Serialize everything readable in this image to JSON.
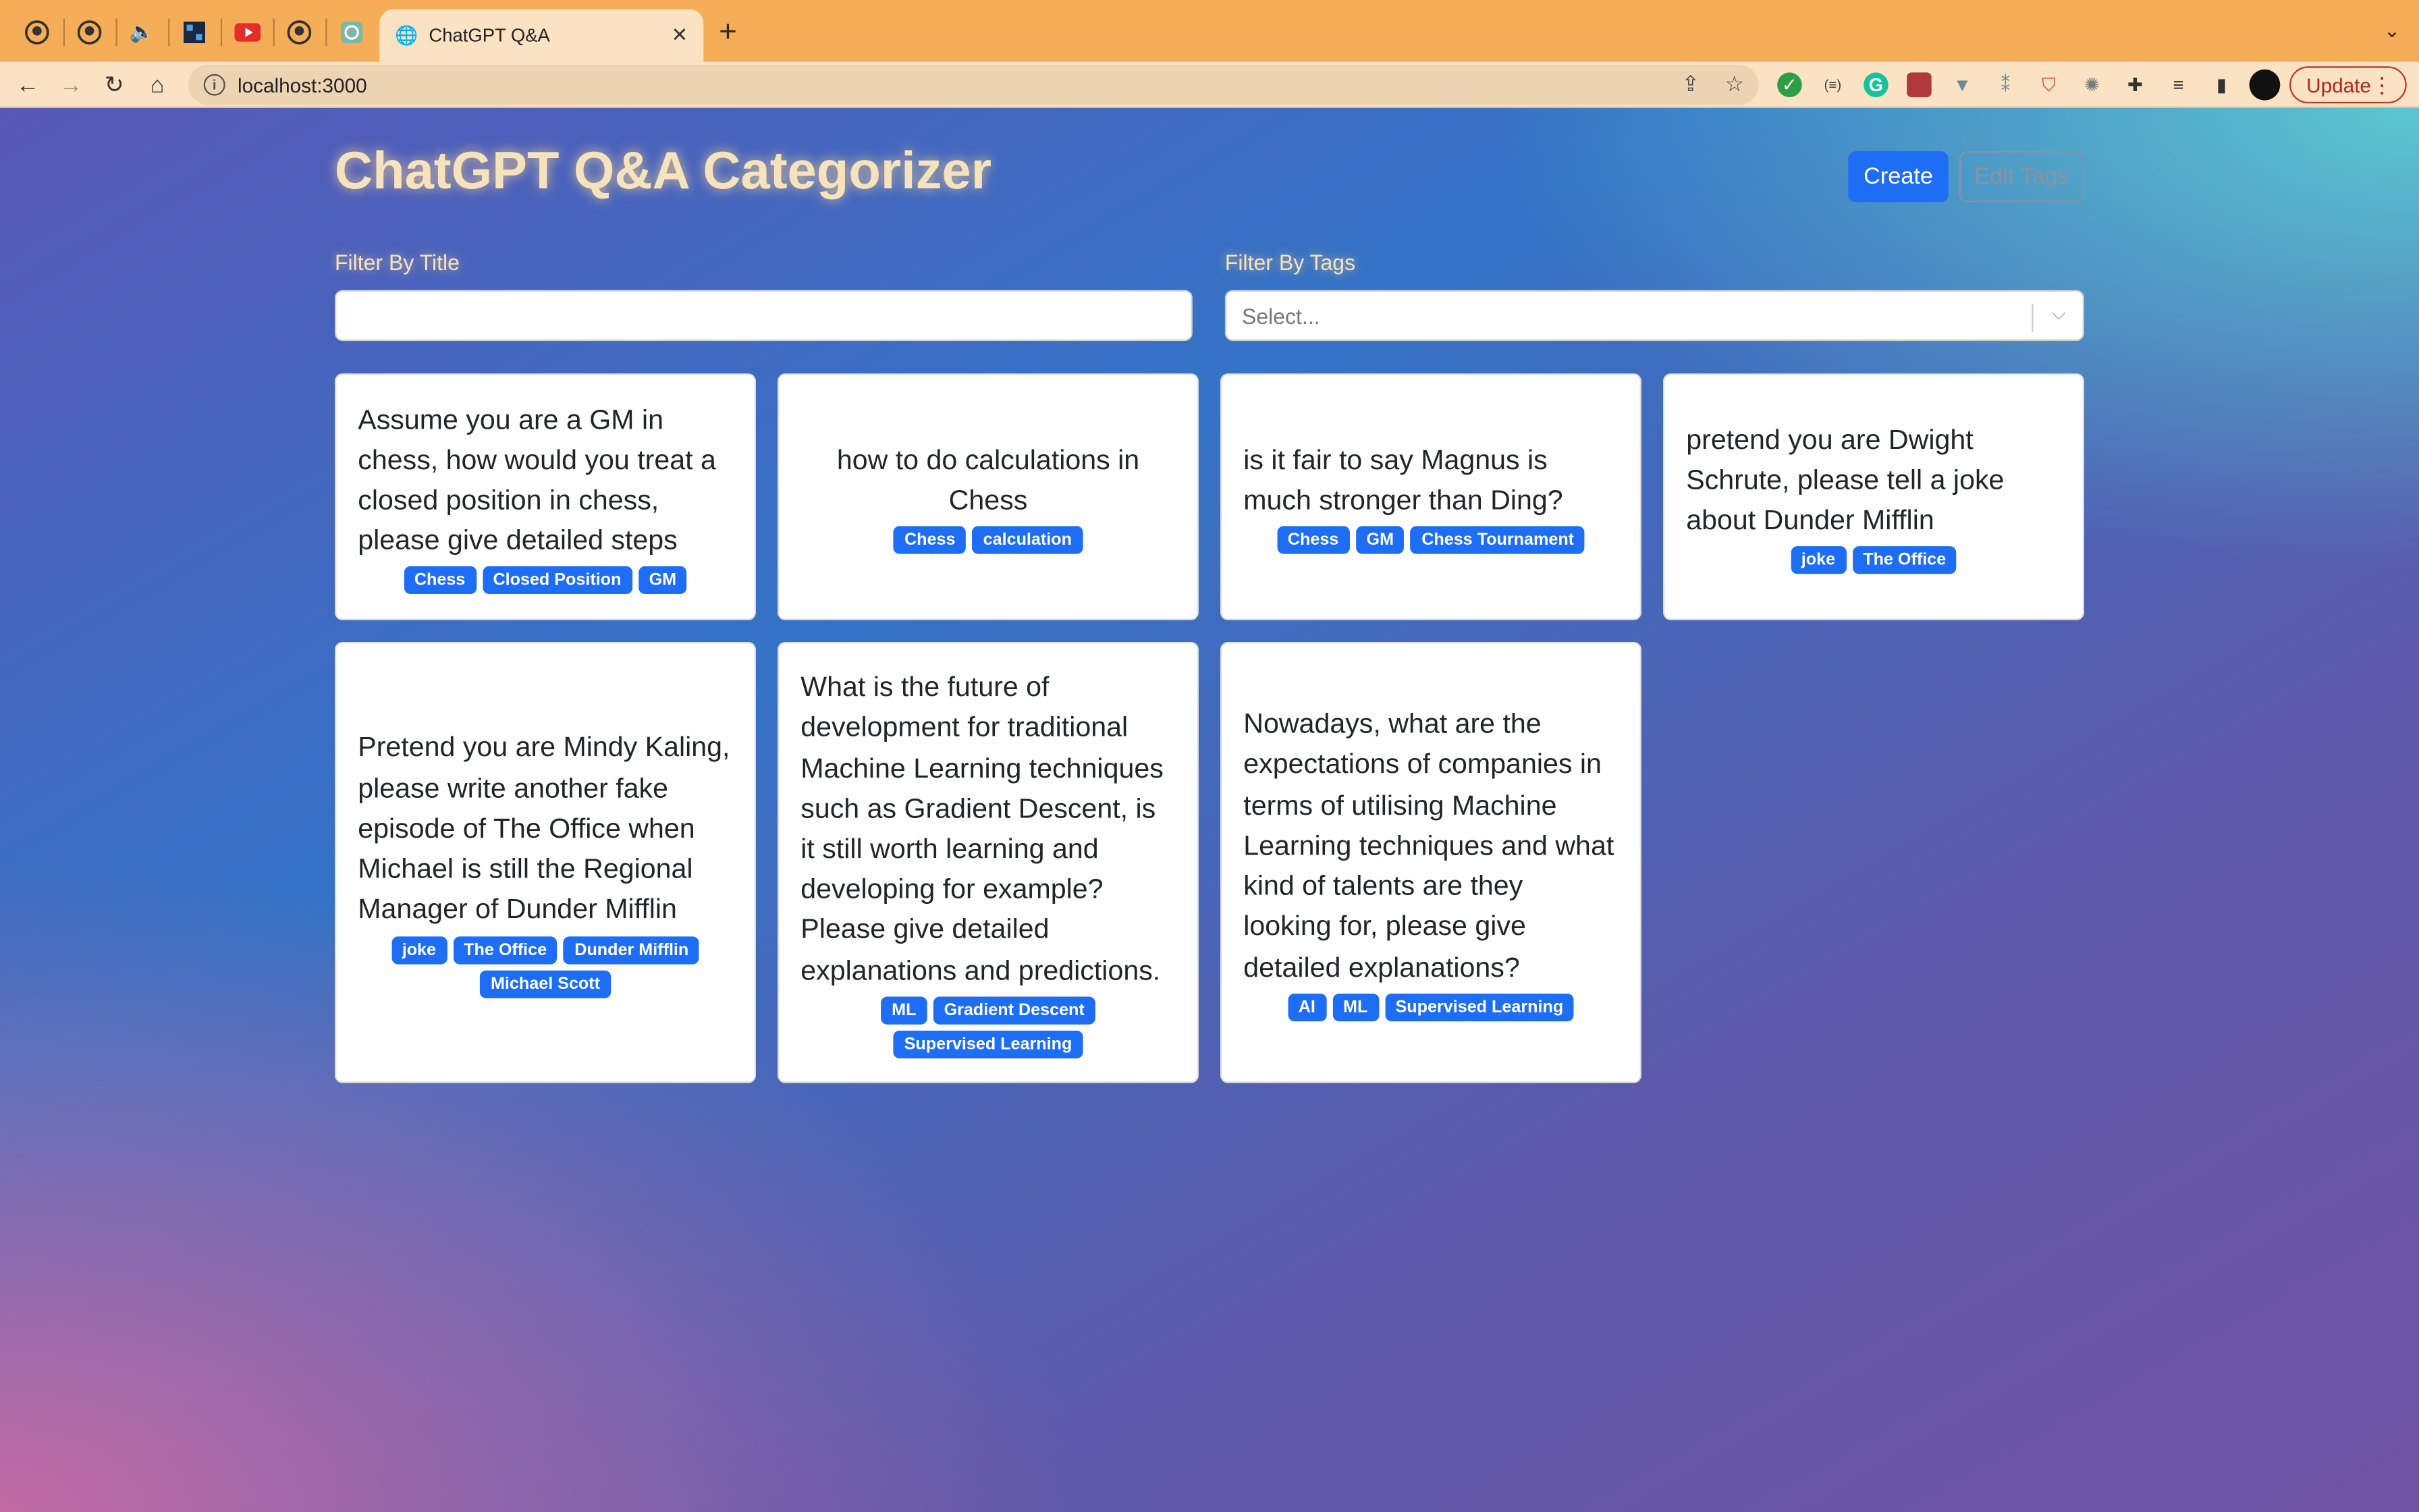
{
  "browser": {
    "tab_title": "ChatGPT Q&A",
    "url": "localhost:3000",
    "update_label": "Update"
  },
  "header": {
    "title": "ChatGPT Q&A Categorizer",
    "create_label": "Create",
    "edit_tags_label": "Edit Tags"
  },
  "filters": {
    "title_label": "Filter By Title",
    "title_value": "",
    "tags_label": "Filter By Tags",
    "tags_placeholder": "Select..."
  },
  "cards": [
    {
      "question": "Assume you are a GM in chess, how would you treat a closed position in chess, please give detailed steps",
      "tags": [
        "Chess",
        "Closed Position",
        "GM"
      ]
    },
    {
      "question": "how to do calculations in Chess",
      "tags": [
        "Chess",
        "calculation"
      ]
    },
    {
      "question": "is it fair to say Magnus is much stronger than Ding?",
      "tags": [
        "Chess",
        "GM",
        "Chess Tournament"
      ]
    },
    {
      "question": "pretend you are Dwight Schrute, please tell a joke about Dunder Mifflin",
      "tags": [
        "joke",
        "The Office"
      ]
    },
    {
      "question": "Pretend you are Mindy Kaling, please write another fake episode of The Office when Michael is still the Regional Manager of Dunder Mifflin",
      "tags": [
        "joke",
        "The Office",
        "Dunder Mifflin",
        "Michael Scott"
      ]
    },
    {
      "question": "What is the future of development for traditional Machine Learning techniques such as Gradient Descent, is it still worth learning and developing for example? Please give detailed explanations and predictions.",
      "tags": [
        "ML",
        "Gradient Descent",
        "Supervised Learning"
      ]
    },
    {
      "question": "Nowadays, what are the expectations of companies in terms of utilising Machine Learning techniques and what kind of talents are they looking for, please give detailed explanations?",
      "tags": [
        "AI",
        "ML",
        "Supervised Learning"
      ]
    }
  ]
}
